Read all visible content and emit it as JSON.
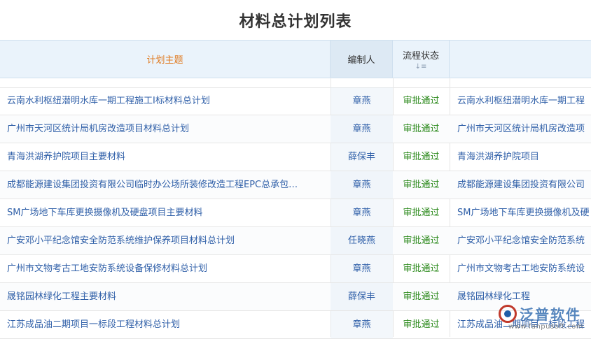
{
  "page": {
    "title": "材料总计划列表"
  },
  "table": {
    "columns": {
      "topic": "计划主题",
      "creator": "编制人",
      "status": "流程状态",
      "project": ""
    },
    "sort_icon": "↓≡",
    "rows": [
      {
        "topic": "云南水利枢纽潜明水库一期工程施工I标材料总计划",
        "creator": "章燕",
        "status": "审批通过",
        "project": "云南水利枢纽潜明水库一期工程"
      },
      {
        "topic": "广州市天河区统计局机房改造项目材料总计划",
        "creator": "章燕",
        "status": "审批通过",
        "project": "广州市天河区统计局机房改造项"
      },
      {
        "topic": "青海洪湖养护院项目主要材料",
        "creator": "薛保丰",
        "status": "审批通过",
        "project": "青海洪湖养护院项目"
      },
      {
        "topic": "成都能源建设集团投资有限公司临时办公场所装修改造工程EPC总承包…",
        "creator": "章燕",
        "status": "审批通过",
        "project": "成都能源建设集团投资有限公司"
      },
      {
        "topic": "SM广场地下车库更换摄像机及硬盘项目主要材料",
        "creator": "章燕",
        "status": "审批通过",
        "project": "SM广场地下车库更换摄像机及硬"
      },
      {
        "topic": "广安邓小平纪念馆安全防范系统维护保养项目材料总计划",
        "creator": "任晓燕",
        "status": "审批通过",
        "project": "广安邓小平纪念馆安全防范系统"
      },
      {
        "topic": "广州市文物考古工地安防系统设备保修材料总计划",
        "creator": "章燕",
        "status": "审批通过",
        "project": "广州市文物考古工地安防系统设"
      },
      {
        "topic": "晟铭园林绿化工程主要材料",
        "creator": "薛保丰",
        "status": "审批通过",
        "project": "晟铭园林绿化工程"
      },
      {
        "topic": "江苏成品油二期项目一标段工程材料总计划",
        "creator": "章燕",
        "status": "审批通过",
        "project": "江苏成品油二期项目一标段工程"
      }
    ]
  },
  "watermark": {
    "name": "泛普软件",
    "url": "www.fanpusoft.com"
  }
}
